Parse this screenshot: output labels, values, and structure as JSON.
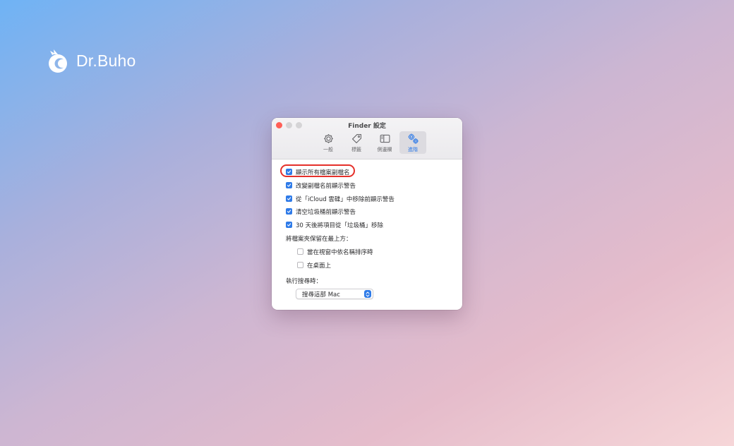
{
  "brand": {
    "name": "Dr.Buho",
    "logo_icon": "owl-logo-icon"
  },
  "window": {
    "title": "Finder 設定",
    "tabs": [
      {
        "label": "一般",
        "icon": "gear-icon",
        "active": false
      },
      {
        "label": "標籤",
        "icon": "tag-icon",
        "active": false
      },
      {
        "label": "側邊欄",
        "icon": "sidebar-icon",
        "active": false
      },
      {
        "label": "進階",
        "icon": "gears-icon",
        "active": true
      }
    ],
    "options": [
      {
        "label": "顯示所有檔案副檔名",
        "checked": true
      },
      {
        "label": "改變副檔名前顯示警告",
        "checked": true
      },
      {
        "label": "從「iCloud 雲碟」中移除前顯示警告",
        "checked": true
      },
      {
        "label": "清空垃圾桶前顯示警告",
        "checked": true
      },
      {
        "label": "30 天後將項目從「垃圾桶」移除",
        "checked": true
      }
    ],
    "folders_heading": "將檔案夾保留在最上方：",
    "folder_options": [
      {
        "label": "當在視窗中依名稱排序時",
        "checked": false
      },
      {
        "label": "在桌面上",
        "checked": false
      }
    ],
    "search_heading": "執行搜尋時：",
    "search_select": {
      "value": "搜尋這部 Mac"
    }
  },
  "colors": {
    "accent": "#2f7be8",
    "highlight": "#e5302a",
    "close": "#ff5f57"
  }
}
